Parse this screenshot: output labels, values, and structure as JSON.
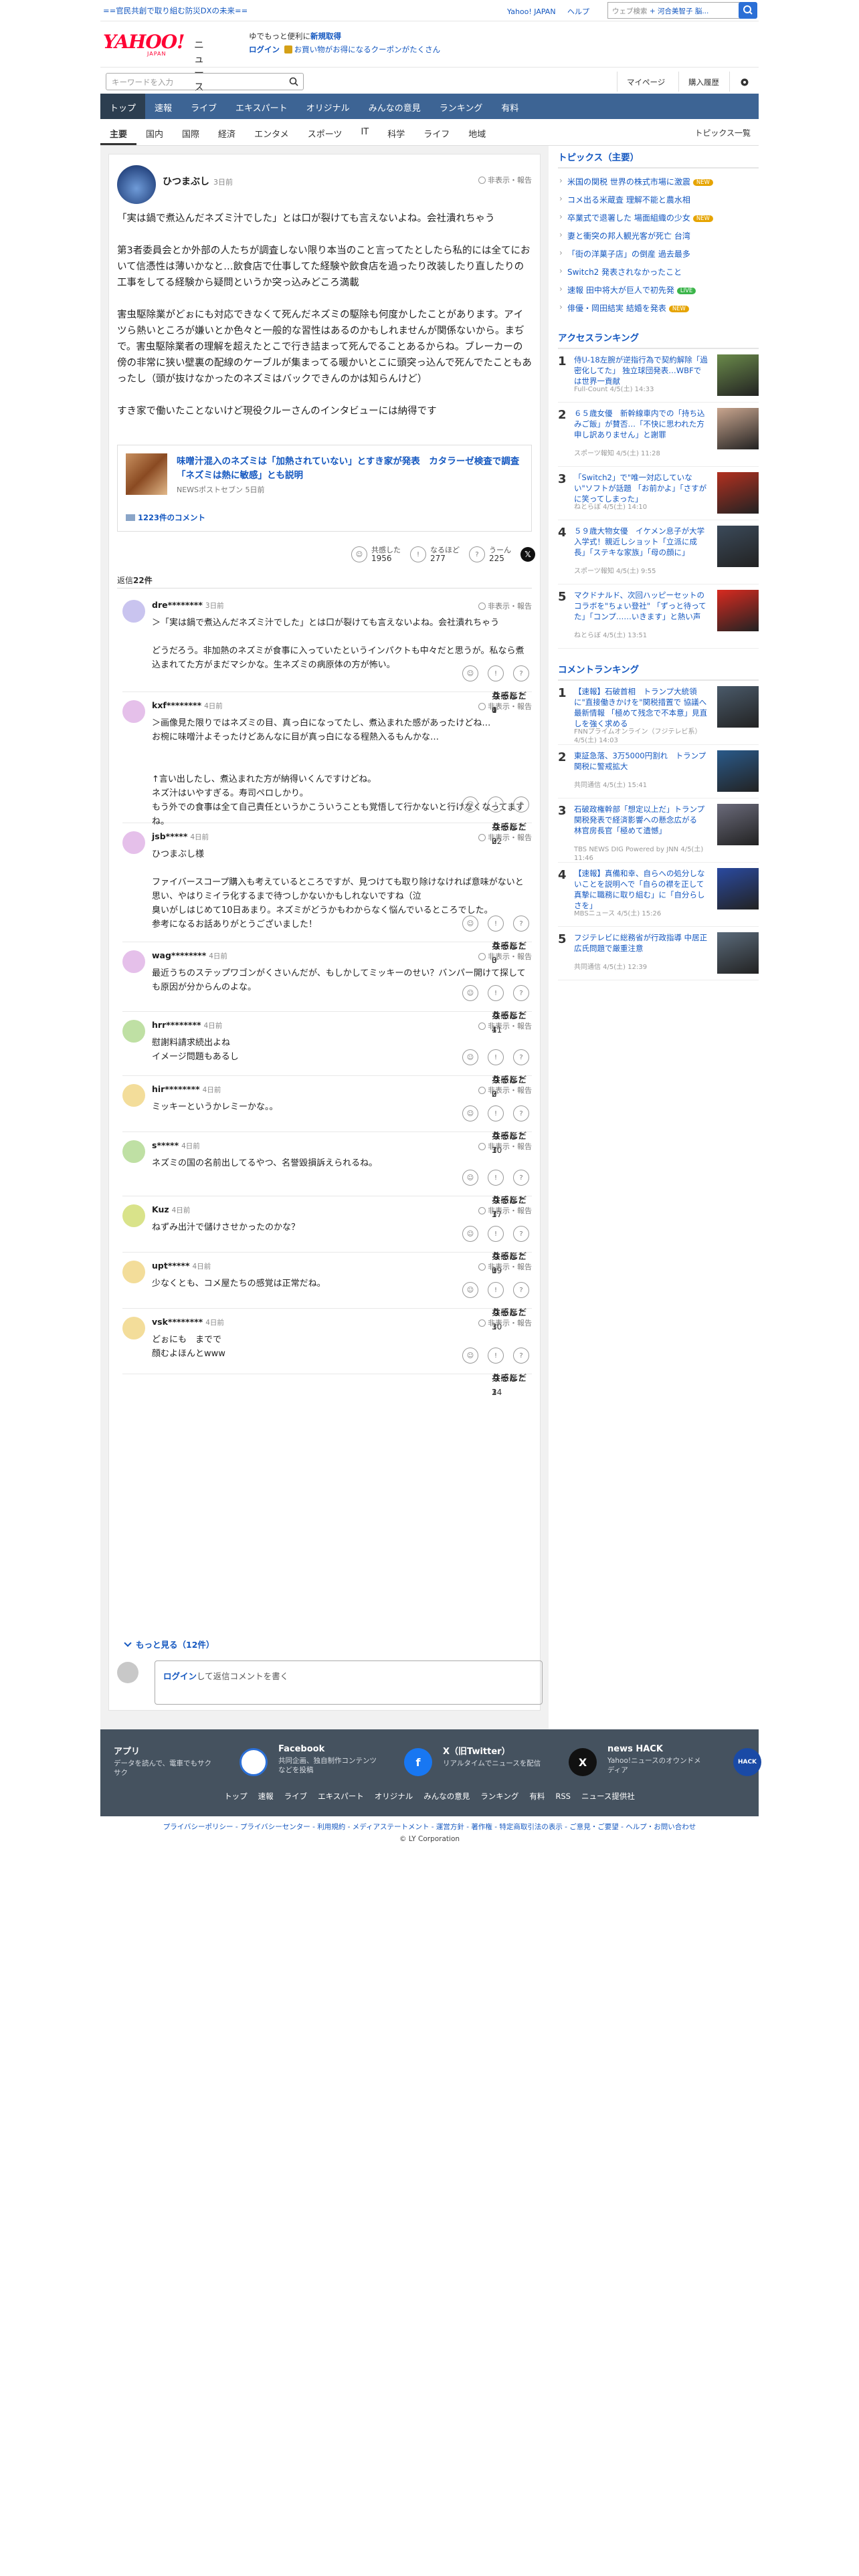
{
  "top": {
    "promo": "==官民共創で取り組む防災DXの未来==",
    "links": [
      "Yahoo! JAPAN",
      "ヘルプ"
    ],
    "web_search_placeholder": "ウェブ検索",
    "web_search_suggest": "+ 河合美智子 脳..."
  },
  "header": {
    "logo": "YAHOO!",
    "logo_sub": "JAPAN",
    "service": "ニュース",
    "msg1a": "ゆでもっと便利に",
    "msg1b": "新規取得",
    "msg2a": "ログイン",
    "msg2b": "お買い物がお得になるクーポンがたくさん"
  },
  "search": {
    "placeholder": "キーワードを入力",
    "mypage": "マイページ",
    "history": "購入履歴"
  },
  "gnav": [
    "トップ",
    "速報",
    "ライブ",
    "エキスパート",
    "オリジナル",
    "みんなの意見",
    "ランキング",
    "有料"
  ],
  "snav": [
    "主要",
    "国内",
    "国際",
    "経済",
    "エンタメ",
    "スポーツ",
    "IT",
    "科学",
    "ライフ",
    "地域"
  ],
  "snav_all": "トピックス一覧",
  "article": {
    "author": "ひつまぶし",
    "time": "3日前",
    "report": "非表示・報告",
    "paragraphs": [
      "「実は鍋で煮込んだネズミ汁でした」とは口が裂けても言えないよね。会社潰れちゃう",
      "第3者委員会とか外部の人たちが調査しない限り本当のこと言ってたとしたら私的には全てにおいて信憑性は薄いかなと…飲食店で仕事してた経験や飲食店を過ったり改装したり直したりの工事をしてる経験から疑問というか突っ込みどころ満載",
      "害虫駆除業がどぉにも対応できなくて死んだネズミの駆除も何度かしたことがあります。アイツら熱いところが嫌いとか色々と一般的な習性はあるのかもしれませんが関係ないから。まぢで。害虫駆除業者の理解を超えたとこで行き詰まって死んでることあるからね。ブレーカーの傍の非常に狭い壁裏の配線のケーブルが集まってる暖かいとこに頭突っ込んで死んでたこともあったし（頭が抜けなかったのネズミはバックできんのかは知らんけど）",
      "すき家で働いたことないけど現役クルーさんのインタビューには納得です"
    ],
    "related": {
      "title": "味噌汁混入のネズミは「加熱されていない」とすき家が発表　カタラーゼ検査で調査　「ネズミは熱に敏感」とも説明",
      "source": "NEWSポストセブン 5日前",
      "comments": "1223件のコメント"
    },
    "reactions": [
      {
        "label": "共感した",
        "count": "1956"
      },
      {
        "label": "なるほど",
        "count": "277"
      },
      {
        "label": "うーん",
        "count": "225"
      }
    ],
    "replies_prefix": "返信",
    "replies_count": "22件"
  },
  "replies": [
    {
      "user": "dre********",
      "time": "3日前",
      "text": "＞「実は鍋で煮込んだネズミ汁でした」とは口が裂けても言えないよね。会社潰れちゃう\n\nどうだろう。非加熱のネズミが食事に入っていたというインパクトも中々だと思うが。私なら煮込まれてた方がまだマシかな。生ネズミの病原体の方が怖い。",
      "color": "#c9c4ef",
      "r": [
        "4",
        "0",
        "1"
      ]
    },
    {
      "user": "kxf********",
      "time": "4日前",
      "text": "＞画像見た限りではネズミの目、真っ白になってたし、煮込まれた感があったけどね…\nお椀に味噌汁よそったけどあんなに目が真っ白になる程熱入るもんかな…\n\n\n↑言い出したし、煮込まれた方が納得いくんですけどね。\nネズ汁はいやすぎる。寿司ペロしかり。\nもう外での食事は全て自己責任というかこういうことも覚悟して行かないと行けなくなってますね。",
      "color": "#e5c0ea",
      "r": [
        "22",
        "0",
        "3"
      ]
    },
    {
      "user": "jsb*****",
      "time": "4日前",
      "text": "ひつまぶし様\n\nファイバースコープ購入も考えているところですが、見つけても取り除けなければ意味がないと思い、やはりミイラ化するまで待つしかないかもしれないですね（泣\n臭いがしはじめて10日あまり。ネズミがどうかもわからなく悩んでいるところでした。\n参考になるお話ありがとうございました！",
      "color": "#e5c0ea",
      "r": [
        "3",
        "0",
        "0"
      ]
    },
    {
      "user": "wag********",
      "time": "4日前",
      "text": "最近うちのステップワゴンがくさいんだが、もしかしてミッキーのせい？バンパー開けて探しても原因が分からんのよな。",
      "color": "#e5c0ea",
      "r": [
        "4",
        "11",
        "1"
      ]
    },
    {
      "user": "hrr********",
      "time": "4日前",
      "text": "慰謝料請求続出よね\nイメージ問題もあるし",
      "color": "#bfe0a4",
      "r": [
        "3",
        "0",
        "2"
      ]
    },
    {
      "user": "hir********",
      "time": "4日前",
      "text": "ミッキーというかレミーかな。。",
      "color": "#f3dd9a",
      "r": [
        "10",
        "7",
        "3"
      ]
    },
    {
      "user": "s*****",
      "time": "4日前",
      "text": "ネズミの国の名前出してるやつ、名誉毀損訴えられるね。",
      "color": "#bfe0a4",
      "r": [
        "7",
        "1",
        "37"
      ]
    },
    {
      "user": "Kuz",
      "time": "4日前",
      "text": "ねずみ出汁で儲けさせかったのかな？",
      "color": "#d9e38a",
      "r": [
        "39",
        "0",
        "1"
      ]
    },
    {
      "user": "upt*****",
      "time": "4日前",
      "text": "少なくとも、コメ屋たちの感覚は正常だね。",
      "color": "#f3dd9a",
      "r": [
        "30",
        "1",
        "3"
      ]
    },
    {
      "user": "vsk********",
      "time": "4日前",
      "text": "どぉにも　までで\n顔むよほんとwww",
      "color": "#f3dd9a",
      "r": [
        "24",
        "1",
        "3"
      ]
    }
  ],
  "more_replies": "もっと見る（12件）",
  "comment_box": {
    "login": "ログイン",
    "rest": "して返信コメントを書く"
  },
  "sidebar": {
    "topics_title": "トピックス（主要）",
    "topics": [
      {
        "t": "米国の関税 世界の株式市場に激震",
        "b": "NEW",
        "c": "#e6a400"
      },
      {
        "t": "コメ出る米蔵査 理解不能と農水相",
        "b": "",
        "c": ""
      },
      {
        "t": "卒業式で退署した 場面組織の少女",
        "b": "NEW",
        "c": "#e6a400"
      },
      {
        "t": "妻と衝突の邦人観光客が死亡 台湾",
        "b": "",
        "c": ""
      },
      {
        "t": "「街の洋菓子店」の倒産 過去最多",
        "b": "",
        "c": ""
      },
      {
        "t": "Switch2 発表されなかったこと",
        "b": "",
        "c": ""
      },
      {
        "t": "速報 田中将大が巨人で初先発",
        "b": "LIVE",
        "c": "#3bb54a"
      },
      {
        "t": "俳優・岡田結実 結婚を発表",
        "b": "NEW",
        "c": "#e6a400"
      }
    ],
    "access_title": "アクセスランキング",
    "access": [
      {
        "n": "1",
        "t": "侍U-18左腕が逆指行為で契約解除「過密化してた」 独立球団発表…WBFでは世界一貢献",
        "s": "Full-Count 4/5(土) 14:33",
        "col": "#6a8a4a"
      },
      {
        "n": "2",
        "t": "６５歳女優　新幹線車内での「持ち込みご飯」が賛否…「不快に思われた方申し訳ありません」と謝罪",
        "s": "スポーツ報知 4/5(土) 11:28",
        "col": "#c9a58e"
      },
      {
        "n": "3",
        "t": "「Switch2」で\"唯一対応していない\"ソフトが話題 「お前かよ」「さすがに笑ってしまった」",
        "s": "ねとらぼ 4/5(土) 14:10",
        "col": "#b23020"
      },
      {
        "n": "4",
        "t": "５９歳大物女優　イケメン息子が大学入学式！親近しショット「立派に成長」「ステキな家族」「母の顔に」",
        "s": "スポーツ報知 4/5(土) 9:55",
        "col": "#3b4a5a"
      },
      {
        "n": "5",
        "t": "マクドナルド、次回ハッピーセットのコラボを\"ちょい登社\" 「ずっと待ってた」「コンプ……いきます」と熱い声",
        "s": "ねとらぼ 4/5(土) 13:51",
        "col": "#d82a20"
      }
    ],
    "comment_title": "コメントランキング",
    "comment": [
      {
        "n": "1",
        "t": "【速報】石破首相　トランプ大統領に\"直接働きかけを\"関税措置で 協議へ最新情報 「極めて残念で不本意」見直しを強く求める",
        "s": "FNNプライムオンライン（フジテレビ系） 4/5(土) 14:03",
        "col": "#4a5a6a"
      },
      {
        "n": "2",
        "t": "東証急落、3万5000円割れ　トランプ関税に警戒拡大",
        "s": "共同通信 4/5(土) 15:41",
        "col": "#2a5a8a"
      },
      {
        "n": "3",
        "t": "石破政権幹部「想定以上だ」トランプ関税発表で経済影響への懸念広がる　林官房長官「極めて遺憾」",
        "s": "TBS NEWS DIG Powered by JNN 4/5(土) 11:46",
        "col": "#6a6a7a"
      },
      {
        "n": "4",
        "t": "【速報】真備和幸、自らへの処分しないことを説明へで「自らの襟を正して真摯に職務に取り組む」に「自分らしさを」",
        "s": "MBSニュース 4/5(土) 15:26",
        "col": "#2a4aa0"
      },
      {
        "n": "5",
        "t": "フジテレビに総務省が行政指導 中居正広氏問題で厳重注意",
        "s": "共同通信 4/5(土) 12:39",
        "col": "#5a6a7a"
      }
    ]
  },
  "footer": {
    "apps": [
      {
        "h": "アプリ",
        "s": "データを読んで、電車でもサクサク",
        "icon": "app",
        "col": "#fff"
      },
      {
        "h": "Facebook",
        "s": "共同企画、独自制作コンテンツなどを投稿",
        "icon": "f",
        "col": "#1877f2"
      },
      {
        "h": "X（旧Twitter）",
        "s": "リアルタイムでニュースを配信",
        "icon": "X",
        "col": "#111"
      },
      {
        "h": "news HACK",
        "s": "Yahoo!ニュースのオウンドメディア",
        "icon": "HACK",
        "col": "#1a4aa6"
      }
    ],
    "nav": [
      "トップ",
      "速報",
      "ライブ",
      "エキスパート",
      "オリジナル",
      "みんなの意見",
      "ランキング",
      "有料",
      "RSS",
      "ニュース提供社"
    ],
    "legal": "プライバシーポリシー - プライバシーセンター - 利用規約 - メディアステートメント - 運営方針 - 著作権 - 特定商取引法の表示 - ご意見・ご要望 - ヘルプ・お問い合わせ",
    "copyright": "© LY Corporation"
  }
}
